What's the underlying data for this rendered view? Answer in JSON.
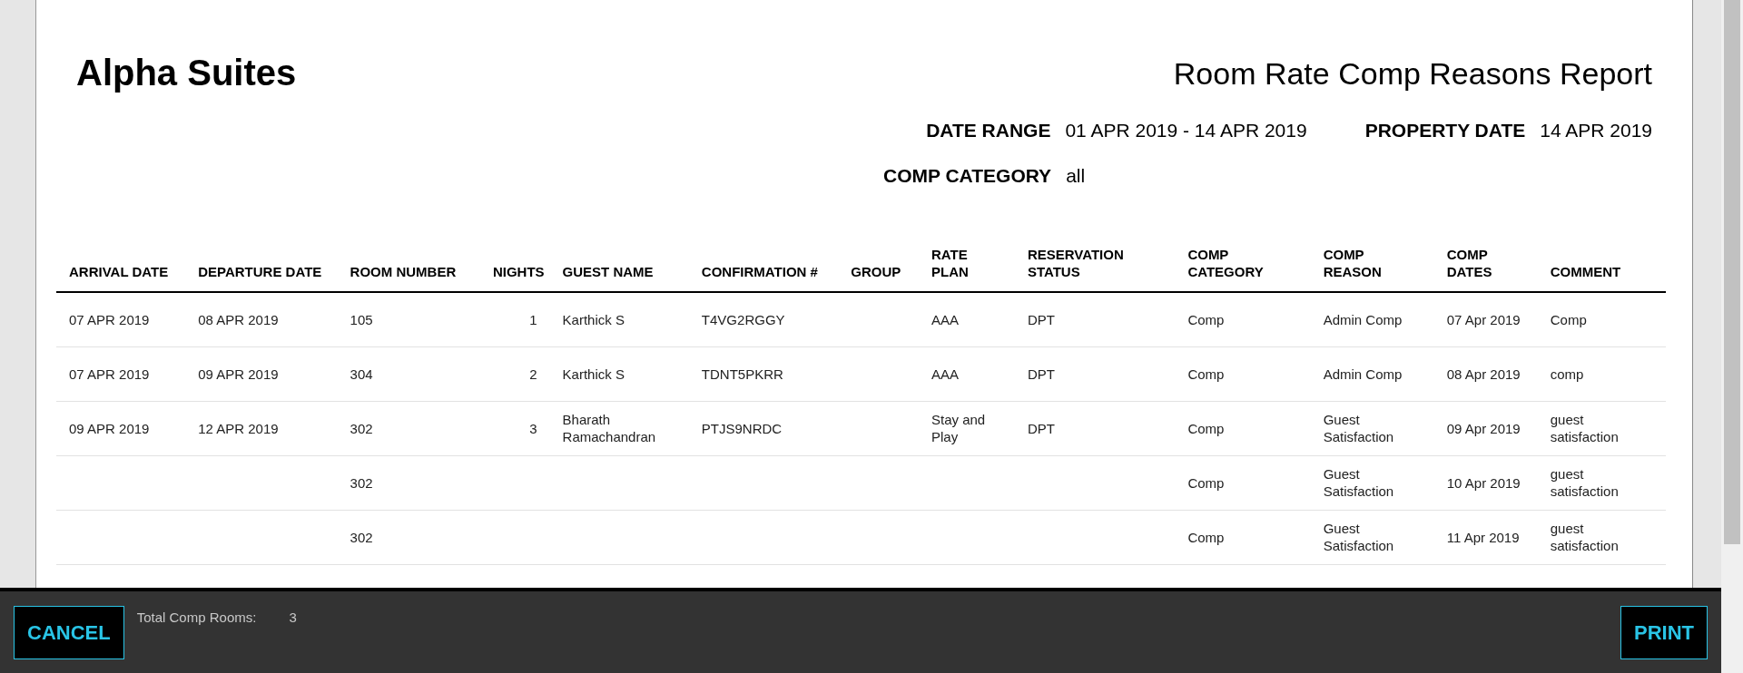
{
  "report": {
    "property": "Alpha Suites",
    "title": "Room Rate Comp Reasons Report",
    "filters": [
      {
        "label": "DATE RANGE",
        "value": "01 APR 2019 - 14 APR 2019"
      },
      {
        "label": "PROPERTY DATE",
        "value": "14 APR 2019"
      },
      {
        "label": "COMP CATEGORY",
        "value": "all"
      }
    ]
  },
  "table": {
    "columns": [
      {
        "label": "ARRIVAL DATE",
        "kind": "text"
      },
      {
        "label": "DEPARTURE DATE",
        "kind": "text"
      },
      {
        "label": "ROOM NUMBER",
        "kind": "text"
      },
      {
        "label": "NIGHTS",
        "kind": "number"
      },
      {
        "label": "GUEST NAME",
        "kind": "text"
      },
      {
        "label": "CONFIRMATION #",
        "kind": "text"
      },
      {
        "label": "GROUP",
        "kind": "text"
      },
      {
        "label": "RATE PLAN",
        "kind": "text"
      },
      {
        "label": "RESERVATION STATUS",
        "kind": "text"
      },
      {
        "label": "COMP CATEGORY",
        "kind": "text"
      },
      {
        "label": "COMP REASON",
        "kind": "text"
      },
      {
        "label": "COMP DATES",
        "kind": "text"
      },
      {
        "label": "COMMENT",
        "kind": "text"
      }
    ],
    "rows": [
      [
        "07 APR 2019",
        "08 APR 2019",
        "105",
        "1",
        "Karthick S",
        "T4VG2RGGY",
        null,
        "AAA",
        "DPT",
        "Comp",
        "Admin Comp",
        "07 Apr 2019",
        "Comp"
      ],
      [
        "07 APR 2019",
        "09 APR 2019",
        "304",
        "2",
        "Karthick S",
        "TDNT5PKRR",
        null,
        "AAA",
        "DPT",
        "Comp",
        "Admin Comp",
        "08 Apr 2019",
        "comp"
      ],
      [
        "09 APR 2019",
        "12 APR 2019",
        "302",
        "3",
        "Bharath Ramachandran",
        "PTJS9NRDC",
        null,
        "Stay and Play",
        "DPT",
        "Comp",
        "Guest Satisfaction",
        "09 Apr 2019",
        "guest satisfaction"
      ],
      [
        null,
        null,
        "302",
        null,
        null,
        null,
        null,
        null,
        null,
        "Comp",
        "Guest Satisfaction",
        "10 Apr 2019",
        "guest satisfaction"
      ],
      [
        null,
        null,
        "302",
        null,
        null,
        null,
        null,
        null,
        null,
        "Comp",
        "Guest Satisfaction",
        "11 Apr 2019",
        "guest satisfaction"
      ]
    ],
    "total": {
      "label": "Total Comp Rooms:",
      "value": "3"
    }
  },
  "footer": {
    "buttons": [
      "CANCEL",
      "PRINT"
    ]
  }
}
